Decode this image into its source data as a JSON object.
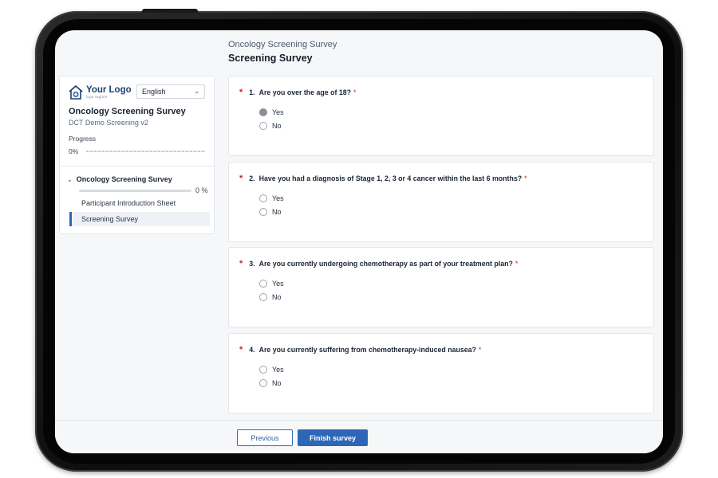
{
  "header": {
    "breadcrumb": "Oncology Screening Survey",
    "title": "Screening Survey"
  },
  "sidebar": {
    "logo_name": "Your Logo",
    "logo_tagline": "logo tagline",
    "language": "English",
    "survey_title": "Oncology Screening Survey",
    "survey_subtitle": "DCT Demo Screening v2",
    "progress_label": "Progress",
    "progress_value": "0%",
    "progress_fraction": 0,
    "section": {
      "title": "Oncology Screening Survey",
      "percent": "0 %",
      "fraction": 0
    },
    "nav_items": [
      {
        "label": "Participant Introduction Sheet",
        "active": false
      },
      {
        "label": "Screening Survey",
        "active": true
      }
    ]
  },
  "questions": [
    {
      "number": "1.",
      "text": "Are you over the age of 18?",
      "options": [
        "Yes",
        "No"
      ]
    },
    {
      "number": "2.",
      "text": "Have you had a diagnosis of Stage 1, 2, 3 or 4 cancer within the last 6 months?",
      "options": [
        "Yes",
        "No"
      ]
    },
    {
      "number": "3.",
      "text": "Are you currently undergoing chemotherapy as part of your treatment plan?",
      "options": [
        "Yes",
        "No"
      ]
    },
    {
      "number": "4.",
      "text": "Are you currently suffering from chemotherapy-induced nausea?",
      "options": [
        "Yes",
        "No"
      ]
    }
  ],
  "required_marker": "*",
  "footer": {
    "previous_label": "Previous",
    "finish_label": "Finish survey"
  },
  "colors": {
    "accent": "#2e66b7",
    "required": "#c9202f",
    "logo": "#1d3f6e"
  }
}
